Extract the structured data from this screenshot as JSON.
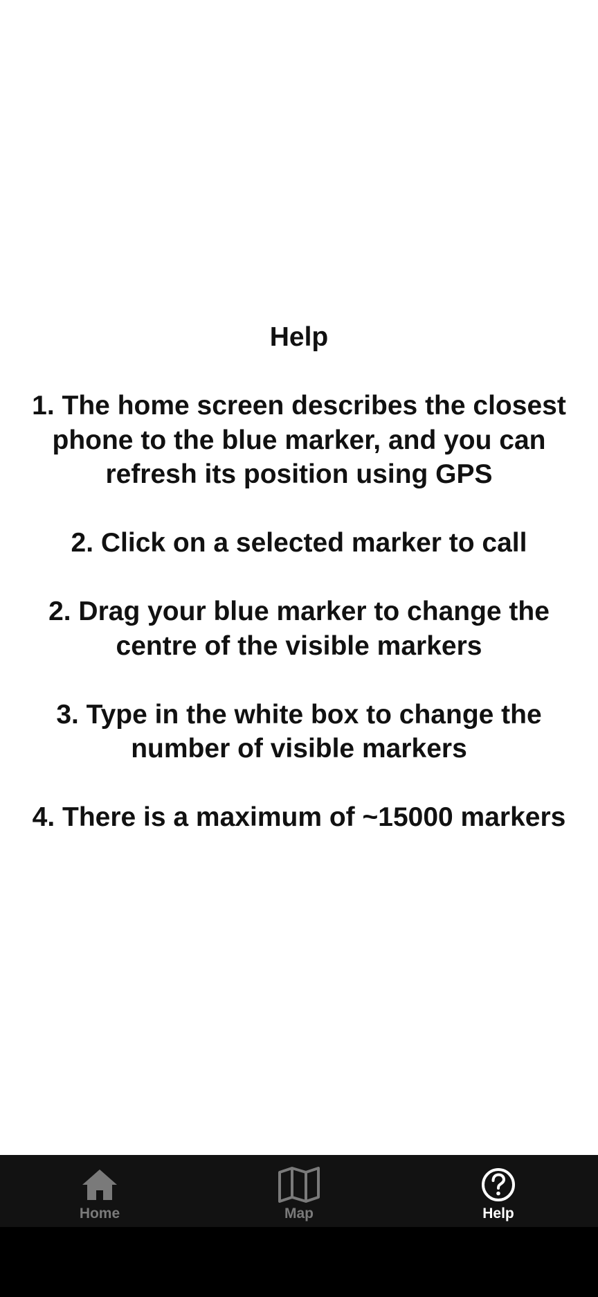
{
  "help": {
    "text": "Help\n\n1. The home screen describes the closest phone to the blue marker, and you can refresh its position using GPS\n\n2. Click on a selected marker to call\n\n2. Drag your blue marker to change the centre of the visible markers\n\n3. Type in the white box to change the number of visible markers\n\n4. There is a maximum of ~15000 markers"
  },
  "tabs": [
    {
      "label": "Home",
      "icon": "home-icon",
      "active": false
    },
    {
      "label": "Map",
      "icon": "map-icon",
      "active": false
    },
    {
      "label": "Help",
      "icon": "help-circle-icon",
      "active": true
    }
  ],
  "colors": {
    "tab_bar_bg": "#121212",
    "tab_inactive": "#7a7a7a",
    "tab_active": "#ffffff",
    "text": "#111111"
  }
}
